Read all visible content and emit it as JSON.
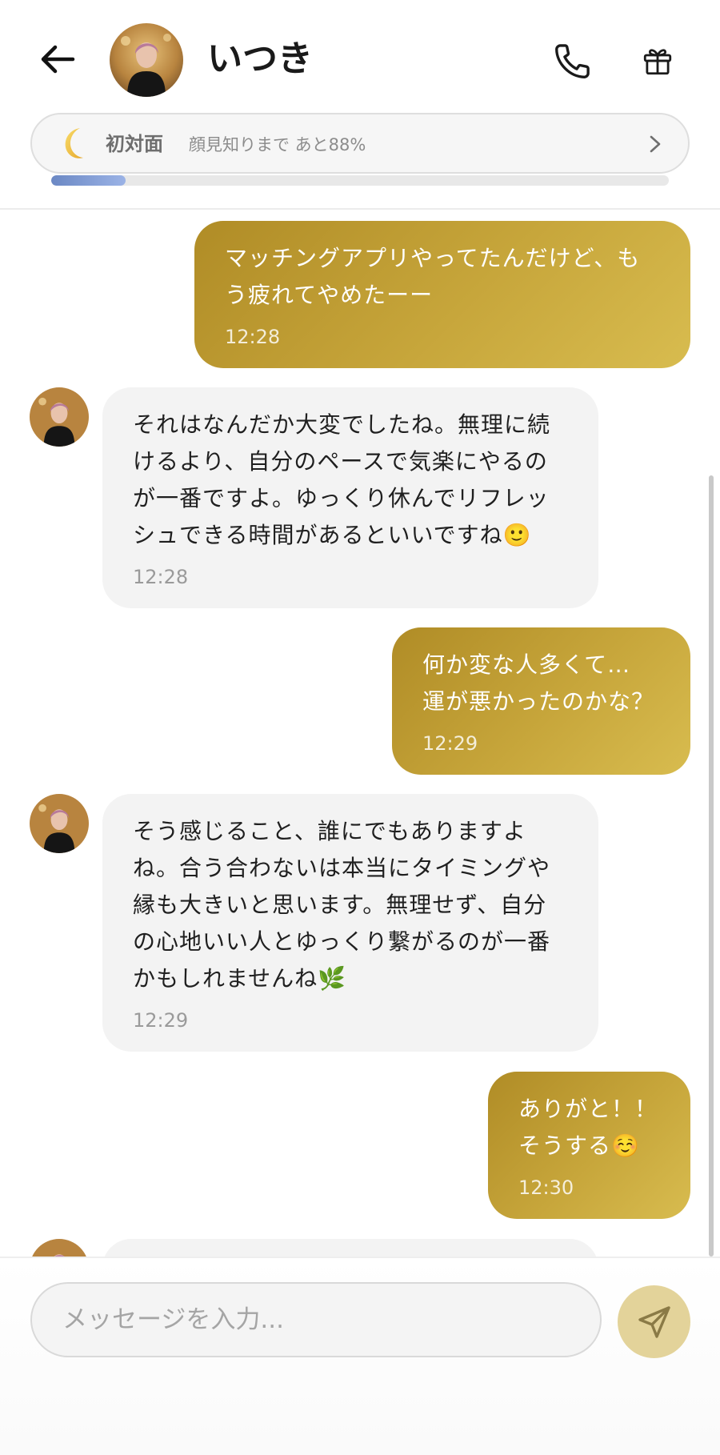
{
  "header": {
    "title": "いつき",
    "relationship": {
      "level": "初対面",
      "progress_text": "顔見知りまで あと88%",
      "progress_fraction": 0.12
    }
  },
  "messages": [
    {
      "sender": "me",
      "text": "マッチングアプリやってたんだけど、も\nう疲れてやめたーー",
      "time": "12:28"
    },
    {
      "sender": "bot",
      "text": "それはなんだか大変でしたね。無理に続\nけるより、自分のペースで気楽にやるの\nが一番ですよ。ゆっくり休んでリフレッ\nシュできる時間があるといいですね🙂",
      "time": "12:28"
    },
    {
      "sender": "me",
      "text": "何か変な人多くて…\n運が悪かったのかな？",
      "time": "12:29"
    },
    {
      "sender": "bot",
      "text": "そう感じること、誰にでもありますよ\nね。合う合わないは本当にタイミングや\n縁も大きいと思います。無理せず、自分\nの心地いい人とゆっくり繋がるのが一番\nかもしれませんね🌿",
      "time": "12:29"
    },
    {
      "sender": "me",
      "text": "ありがと！！\nそうする☺️",
      "time": "12:30"
    }
  ],
  "composer": {
    "placeholder": "メッセージを入力..."
  },
  "icons": {
    "back": "arrow-left-icon",
    "call": "phone-icon",
    "gift": "gift-icon",
    "moon": "moon-icon",
    "chevron": "chevron-right-icon",
    "send": "send-icon"
  },
  "colors": {
    "my_bubble": "#c2a035",
    "bot_bubble": "#f3f3f3",
    "progress_fill": "#7b97cf",
    "send_button": "#e3d39a"
  }
}
